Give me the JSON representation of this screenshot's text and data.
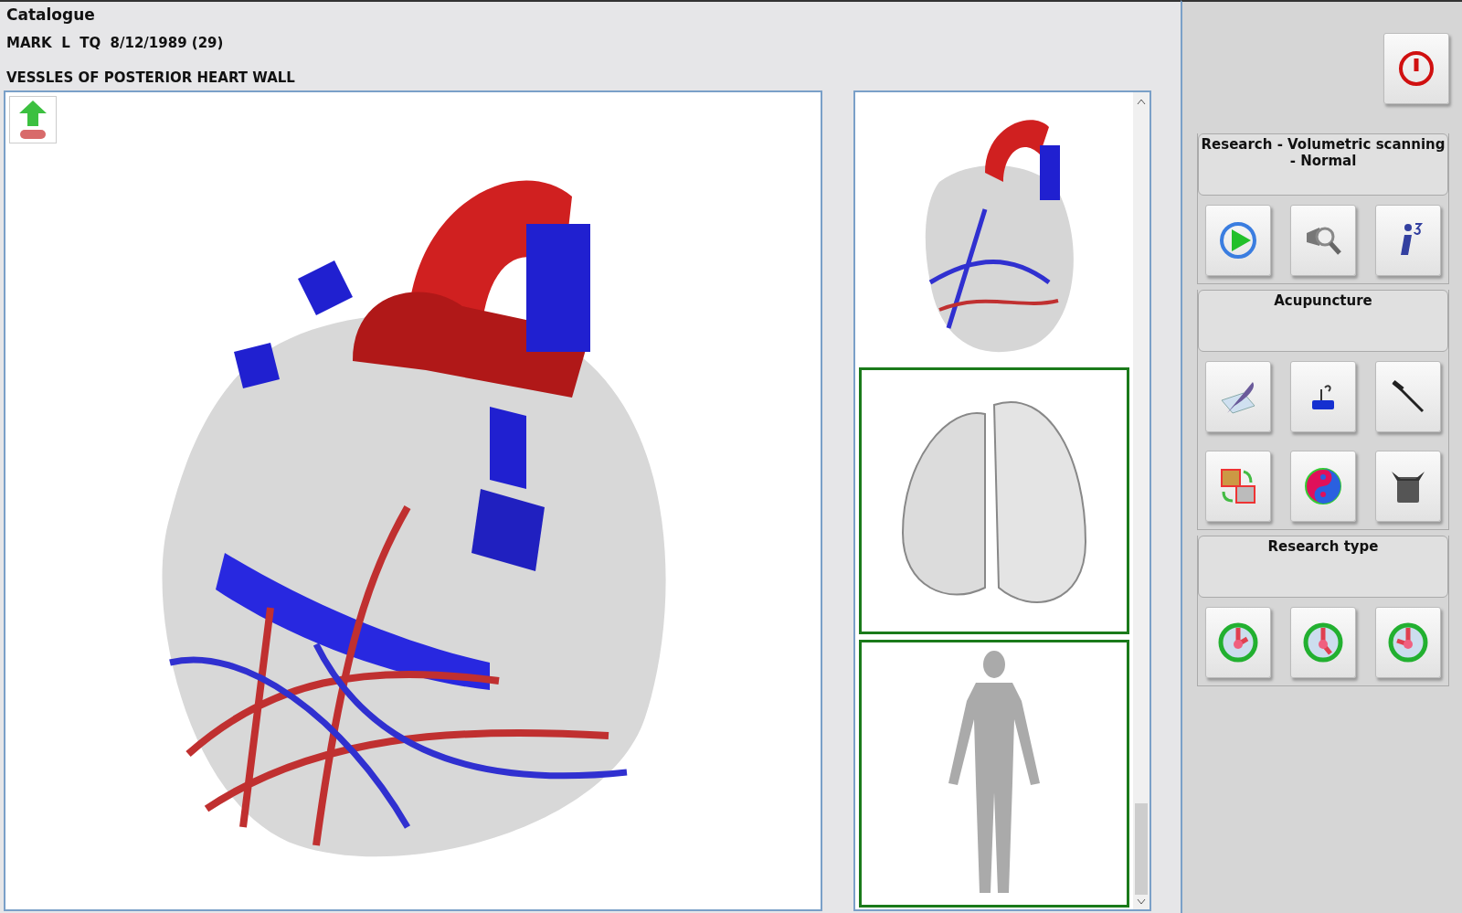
{
  "header": {
    "title": "Catalogue",
    "patient": "MARK  L  TQ  8/12/1989 (29)",
    "section": "VESSLES OF POSTERIOR HEART WALL"
  },
  "thumbnails": [
    {
      "kind": "heart",
      "highlighted": false
    },
    {
      "kind": "lungs",
      "highlighted": true
    },
    {
      "kind": "body",
      "highlighted": true
    }
  ],
  "groups": [
    {
      "title": "Research - Volumetric scanning - Normal",
      "buttons": [
        {
          "kind": "play"
        },
        {
          "kind": "magnifier"
        },
        {
          "kind": "info"
        }
      ]
    },
    {
      "title": "Acupuncture",
      "buttons": [
        {
          "kind": "quill"
        },
        {
          "kind": "stamp"
        },
        {
          "kind": "needle"
        },
        {
          "kind": "swap"
        },
        {
          "kind": "yinyang"
        },
        {
          "kind": "pot"
        }
      ]
    },
    {
      "title": "Research type",
      "buttons": [
        {
          "kind": "target-a"
        },
        {
          "kind": "target-b"
        },
        {
          "kind": "target-c"
        }
      ]
    }
  ]
}
